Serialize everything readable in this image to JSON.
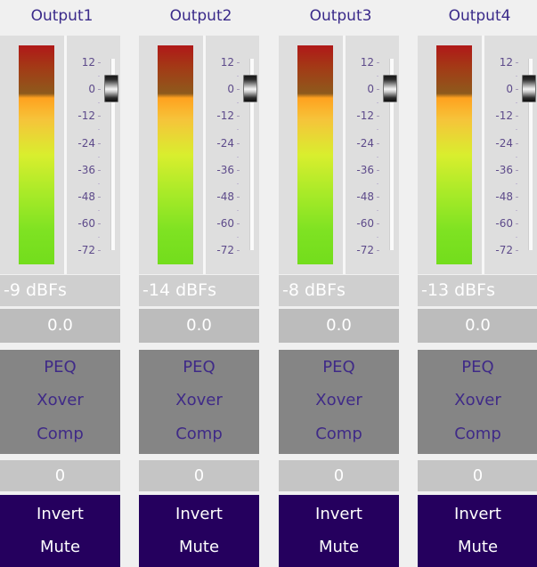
{
  "outputs": [
    {
      "title": "Output1",
      "dbfs": "-9 dBFs",
      "gain": "0.0",
      "value": "0",
      "meter_level": 0.99
    },
    {
      "title": "Output2",
      "dbfs": "-14 dBFs",
      "gain": "0.0",
      "value": "0",
      "meter_level": 0.99
    },
    {
      "title": "Output3",
      "dbfs": "-8 dBFs",
      "gain": "0.0",
      "value": "0",
      "meter_level": 0.99
    },
    {
      "title": "Output4",
      "dbfs": "-13 dBFs",
      "gain": "0.0",
      "value": "0",
      "meter_level": 0.99
    }
  ],
  "scale_labels": [
    "12",
    "0",
    "-12",
    "-24",
    "-36",
    "-48",
    "-60",
    "-72"
  ],
  "buttons": {
    "peq": "PEQ",
    "xover": "Xover",
    "comp": "Comp",
    "invert": "Invert",
    "mute": "Mute"
  },
  "colors": {
    "title": "#3a2a8a",
    "panel": "#dedede",
    "button_block": "#858585",
    "purple_block": "#25005e"
  }
}
